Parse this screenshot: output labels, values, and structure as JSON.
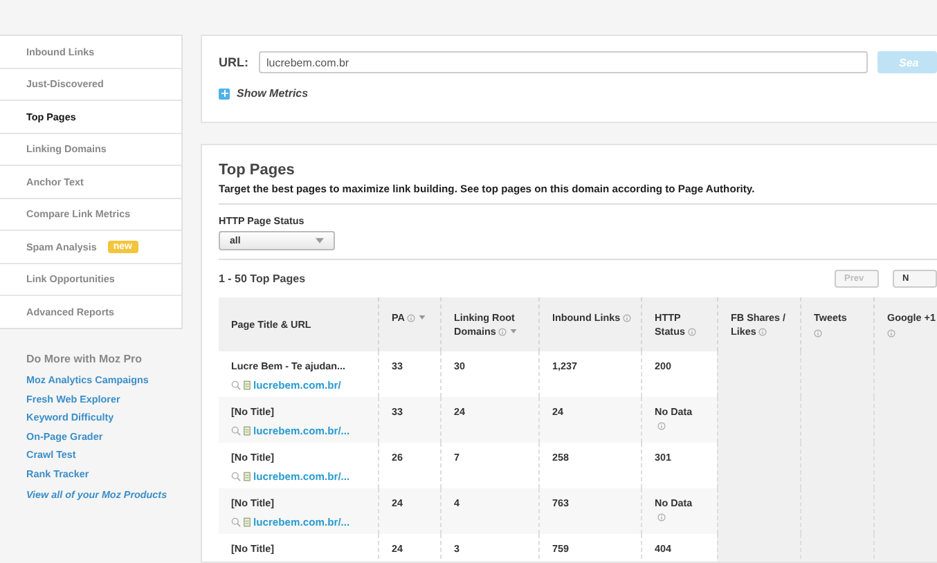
{
  "sidebar": {
    "nav": [
      {
        "label": "Inbound Links",
        "selected": false
      },
      {
        "label": "Just-Discovered",
        "selected": false
      },
      {
        "label": "Top Pages",
        "selected": true
      },
      {
        "label": "Linking Domains",
        "selected": false
      },
      {
        "label": "Anchor Text",
        "selected": false
      },
      {
        "label": "Compare Link Metrics",
        "selected": false
      },
      {
        "label": "Spam Analysis",
        "selected": false,
        "badge": "new"
      },
      {
        "label": "Link Opportunities",
        "selected": false
      },
      {
        "label": "Advanced Reports",
        "selected": false
      }
    ],
    "more": {
      "title": "Do More with Moz Pro",
      "links": [
        "Moz Analytics Campaigns",
        "Fresh Web Explorer",
        "Keyword Difficulty",
        "On-Page Grader",
        "Crawl Test",
        "Rank Tracker"
      ],
      "footer_link": "View all of your Moz Products"
    }
  },
  "url_bar": {
    "label": "URL:",
    "value": "lucrebem.com.br",
    "button": "Sea",
    "toggle": "Show Metrics",
    "expanded": false
  },
  "top_pages": {
    "title": "Top Pages",
    "description": "Target the best pages to maximize link building. See top pages on this domain according to Page Authority.",
    "filter": {
      "label": "HTTP Page Status",
      "value": "all"
    },
    "count": "1 - 50 Top Pages",
    "pager": [
      {
        "label": "Prev",
        "disabled": true
      },
      {
        "label": "N",
        "disabled": false
      }
    ],
    "table": {
      "columns": [
        {
          "label": "Page Title & URL",
          "info": false,
          "sort": false
        },
        {
          "label": "PA",
          "info": true,
          "sort": true
        },
        {
          "label": "Linking Root Domains",
          "info": true,
          "sort": true
        },
        {
          "label": "Inbound Links",
          "info": true,
          "sort": false
        },
        {
          "label": "HTTP Status",
          "info": true,
          "sort": false
        },
        {
          "label": "FB Shares / Likes",
          "info": true,
          "sort": false
        },
        {
          "label": "Tweets",
          "info": true,
          "sort": false
        },
        {
          "label": "Google +1",
          "info": true,
          "sort": false
        }
      ],
      "rows": [
        {
          "cells": [
            {
              "title": "Lucre Bem - Te ajudan...",
              "url": "lucrebem.com.br/"
            },
            "33",
            "30",
            "1,237",
            "200"
          ],
          "status_info": false
        },
        {
          "cells": [
            {
              "title": "[No Title]",
              "url": "lucrebem.com.br/..."
            },
            "33",
            "24",
            "24",
            "No Data"
          ],
          "status_info": true
        },
        {
          "cells": [
            {
              "title": "[No Title]",
              "url": "lucrebem.com.br/..."
            },
            "26",
            "7",
            "258",
            "301"
          ],
          "status_info": false
        },
        {
          "cells": [
            {
              "title": "[No Title]",
              "url": "lucrebem.com.br/..."
            },
            "24",
            "4",
            "763",
            "No Data"
          ],
          "status_info": true
        },
        {
          "cells": [
            {
              "title": "[No Title]"
            },
            "24",
            "3",
            "759",
            "404"
          ],
          "status_info": false
        }
      ]
    }
  }
}
